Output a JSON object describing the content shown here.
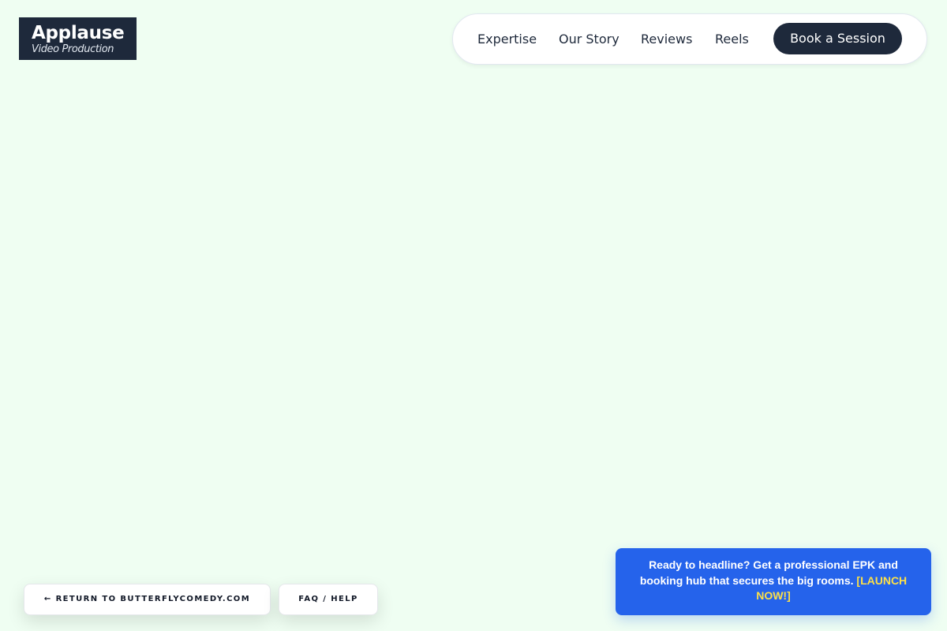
{
  "brand": {
    "title": "Applause",
    "subtitle": "Video Production"
  },
  "nav": {
    "items": [
      {
        "label": "Expertise"
      },
      {
        "label": "Our Story"
      },
      {
        "label": "Reviews"
      },
      {
        "label": "Reels"
      }
    ],
    "cta_label": "Book a Session"
  },
  "footer_buttons": {
    "return_label": "← RETURN TO BUTTERFLYCOMEDY.COM",
    "faq_label": "FAQ / HELP"
  },
  "promo": {
    "text": "Ready to headline? Get a professional EPK and booking hub that secures the big rooms.",
    "link_label": "[LAUNCH NOW!]"
  },
  "colors": {
    "page_background": "#effef2",
    "dark": "#1e293b",
    "promo_blue": "#2563eb",
    "promo_link": "#fde047"
  }
}
